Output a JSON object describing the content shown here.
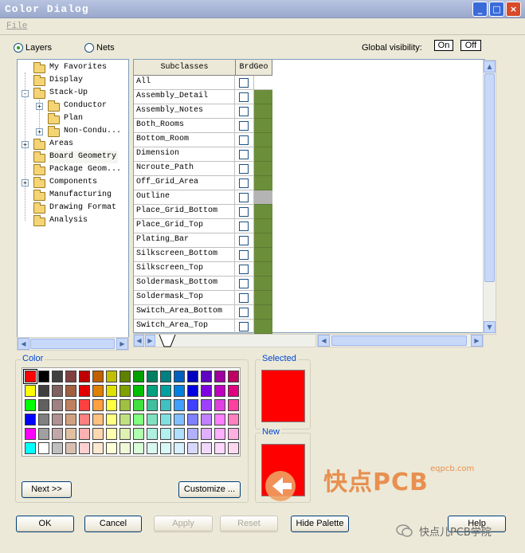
{
  "window": {
    "title": "Color Dialog"
  },
  "menu": {
    "file": "File"
  },
  "view_mode": {
    "layers": "Layers",
    "nets": "Nets",
    "selected": "layers"
  },
  "global_visibility": {
    "label": "Global visibility:",
    "on": "On",
    "off": "Off"
  },
  "tree": {
    "nodes": [
      {
        "label": "My Favorites",
        "depth": 1,
        "expander": ""
      },
      {
        "label": "Display",
        "depth": 1,
        "expander": ""
      },
      {
        "label": "Stack-Up",
        "depth": 1,
        "expander": "-"
      },
      {
        "label": "Conductor",
        "depth": 2,
        "expander": "+"
      },
      {
        "label": "Plan",
        "depth": 2,
        "expander": ""
      },
      {
        "label": "Non-Condu...",
        "depth": 2,
        "expander": "+"
      },
      {
        "label": "Areas",
        "depth": 1,
        "expander": "+"
      },
      {
        "label": "Board Geometry",
        "depth": 1,
        "expander": "",
        "selected": true
      },
      {
        "label": "Package Geom...",
        "depth": 1,
        "expander": ""
      },
      {
        "label": "Components",
        "depth": 1,
        "expander": "+"
      },
      {
        "label": "Manufacturing",
        "depth": 1,
        "expander": ""
      },
      {
        "label": "Drawing Format",
        "depth": 1,
        "expander": ""
      },
      {
        "label": "Analysis",
        "depth": 1,
        "expander": ""
      }
    ]
  },
  "grid": {
    "col_subclasses": "Subclasses",
    "col_class": "BrdGeo",
    "rows": [
      {
        "name": "All",
        "color": "#ffffff"
      },
      {
        "name": "Assembly_Detail",
        "color": "#6b8e3a"
      },
      {
        "name": "Assembly_Notes",
        "color": "#6b8e3a"
      },
      {
        "name": "Both_Rooms",
        "color": "#6b8e3a"
      },
      {
        "name": "Bottom_Room",
        "color": "#6b8e3a"
      },
      {
        "name": "Dimension",
        "color": "#6b8e3a"
      },
      {
        "name": "Ncroute_Path",
        "color": "#6b8e3a"
      },
      {
        "name": "Off_Grid_Area",
        "color": "#6b8e3a"
      },
      {
        "name": "Outline",
        "color": "#b4b4b4"
      },
      {
        "name": "Place_Grid_Bottom",
        "color": "#6b8e3a"
      },
      {
        "name": "Place_Grid_Top",
        "color": "#6b8e3a"
      },
      {
        "name": "Plating_Bar",
        "color": "#6b8e3a"
      },
      {
        "name": "Silkscreen_Bottom",
        "color": "#6b8e3a"
      },
      {
        "name": "Silkscreen_Top",
        "color": "#6b8e3a"
      },
      {
        "name": "Soldermask_Bottom",
        "color": "#6b8e3a"
      },
      {
        "name": "Soldermask_Top",
        "color": "#6b8e3a"
      },
      {
        "name": "Switch_Area_Bottom",
        "color": "#6b8e3a"
      },
      {
        "name": "Switch_Area_Top",
        "color": "#6b8e3a"
      }
    ]
  },
  "color_group": {
    "label": "Color",
    "palette": [
      [
        "#ff0000",
        "#000000",
        "#404040",
        "#804040",
        "#c00000",
        "#c06000",
        "#c0c000",
        "#608000",
        "#00a000",
        "#008060",
        "#008080",
        "#0060c0",
        "#0000c0",
        "#6000c0",
        "#a000a0",
        "#c00060"
      ],
      [
        "#ffff00",
        "#404040",
        "#806060",
        "#a06040",
        "#e00000",
        "#e08000",
        "#e0e000",
        "#80a000",
        "#00c000",
        "#00a080",
        "#00a0a0",
        "#0080e0",
        "#0000e0",
        "#8000e0",
        "#c000c0",
        "#e00080"
      ],
      [
        "#00ff00",
        "#606060",
        "#a08080",
        "#c08060",
        "#ff4040",
        "#ffa040",
        "#ffff40",
        "#a0c040",
        "#40e040",
        "#40c0a0",
        "#40c0c0",
        "#40a0ff",
        "#4040ff",
        "#a040ff",
        "#e040e0",
        "#ff40a0"
      ],
      [
        "#0000ff",
        "#808080",
        "#b09090",
        "#d0a080",
        "#ff8080",
        "#ffc080",
        "#ffff80",
        "#c0e080",
        "#80ff80",
        "#80e0c0",
        "#80e0e0",
        "#80c0ff",
        "#8080ff",
        "#c080ff",
        "#ff80ff",
        "#ff80c0"
      ],
      [
        "#ff00ff",
        "#a0a0a0",
        "#c0a8a8",
        "#e0c0a0",
        "#ffb0b0",
        "#ffd8b0",
        "#ffffb0",
        "#e0f0b0",
        "#b0ffb0",
        "#b0f0e0",
        "#b0f0f0",
        "#b0e0ff",
        "#b0b0ff",
        "#e0b0ff",
        "#ffb0ff",
        "#ffb0e0"
      ],
      [
        "#00ffff",
        "#ffffff",
        "#c0c0c0",
        "#d8c0b0",
        "#ffd0d0",
        "#ffe8d0",
        "#ffffd8",
        "#f0f8d8",
        "#d8ffd8",
        "#d8f8f0",
        "#d8f8f8",
        "#d8f0ff",
        "#d8d8ff",
        "#f0d8ff",
        "#ffd8ff",
        "#ffd8f0"
      ]
    ],
    "next_button": "Next >>",
    "customize_button": "Customize ..."
  },
  "selected_group": {
    "label": "Selected",
    "color": "#ff0000"
  },
  "new_group": {
    "label": "New",
    "color": "#ff0000"
  },
  "footer": {
    "ok": "OK",
    "cancel": "Cancel",
    "apply": "Apply",
    "reset": "Reset",
    "hide_palette": "Hide Palette",
    "help": "Help"
  },
  "watermark": {
    "brand": "快点PCB",
    "site": "eqpcb.com",
    "wechat": "快点儿PCB学院"
  }
}
